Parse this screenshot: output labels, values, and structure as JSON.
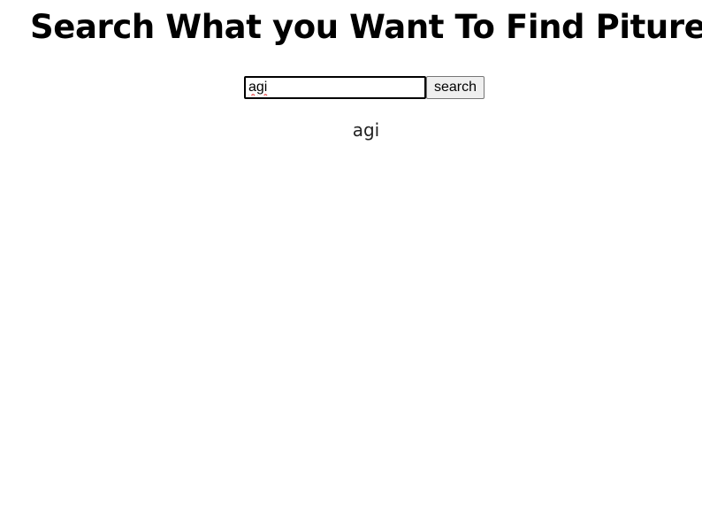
{
  "header": {
    "title": "Search What you Want To Find Pitures"
  },
  "search": {
    "value": "agi",
    "button_label": "search"
  },
  "results": {
    "query_text": "agi"
  }
}
